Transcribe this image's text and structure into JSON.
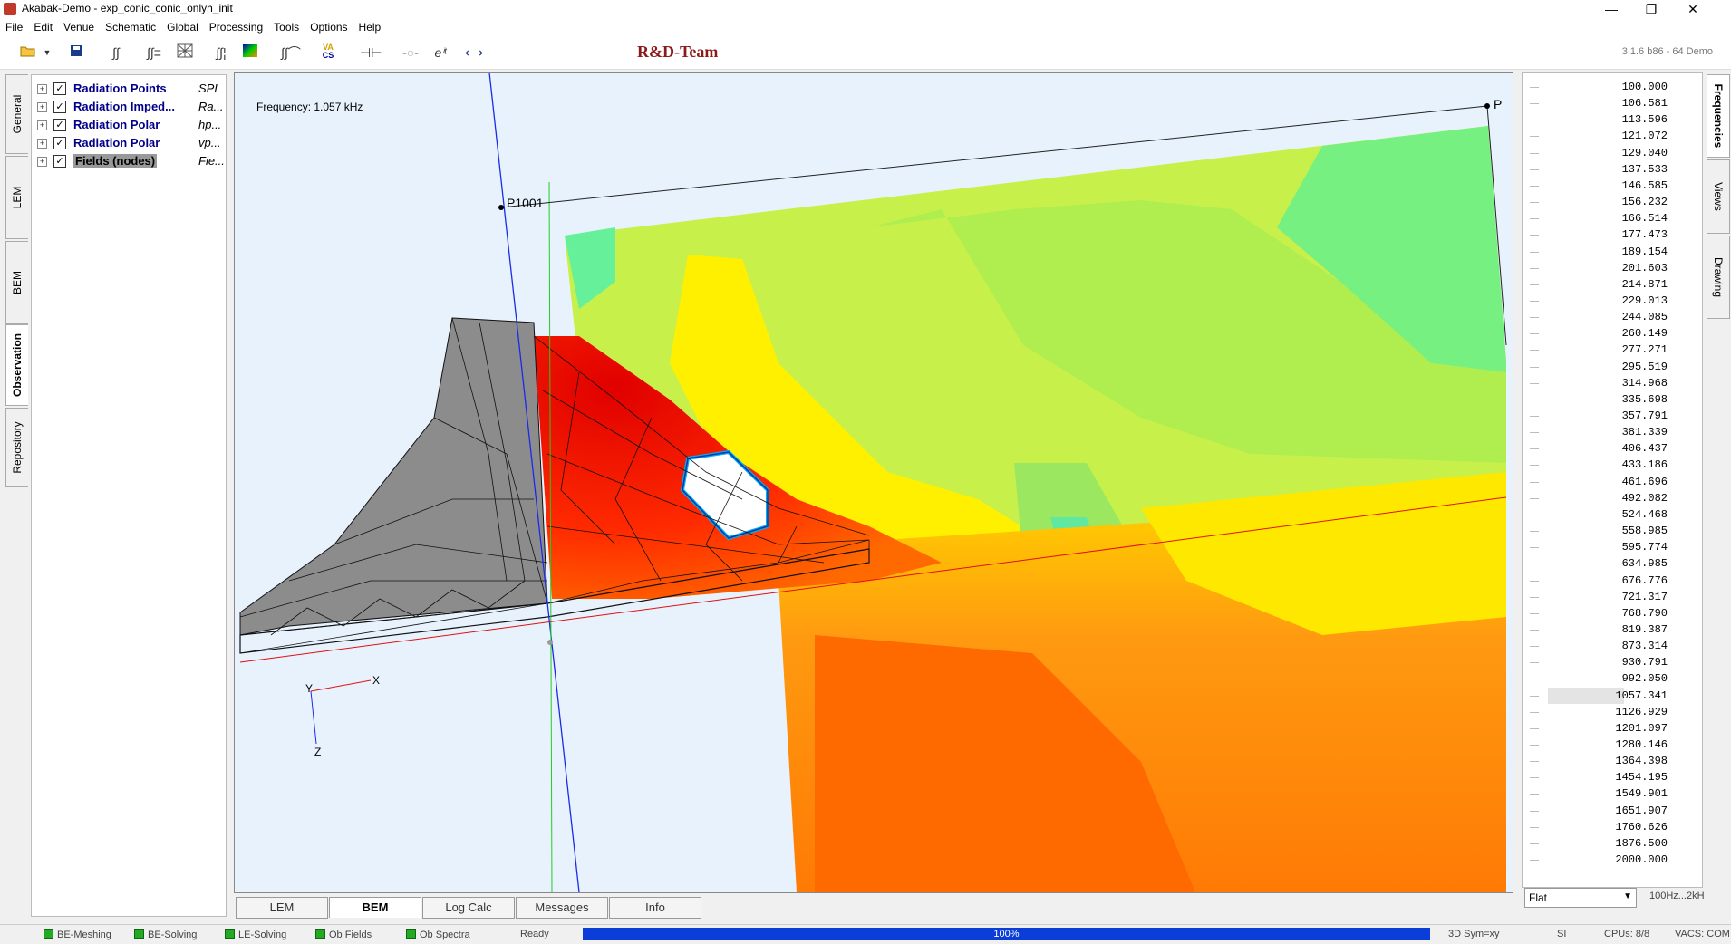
{
  "window": {
    "title": "Akabak-Demo - exp_conic_conic_onlyh_init",
    "minimize": "—",
    "restore": "❐",
    "close": "✕"
  },
  "menu": [
    "File",
    "Edit",
    "Venue",
    "Schematic",
    "Global",
    "Processing",
    "Tools",
    "Options",
    "Help"
  ],
  "toolbar": {
    "icons": [
      "open-folder-icon",
      "dropdown-arrow-icon",
      "save-icon",
      "integral-icon",
      "double-integral-icon",
      "mesh-icon",
      "integral-bars-icon",
      "color-map-icon",
      "integral-curve-icon",
      "vacs-icon",
      "component-icon",
      "filter-icon",
      "exp-icon",
      "arrow-icon"
    ],
    "vacs_label_top": "VA",
    "vacs_label_bottom": "CS",
    "exp_label": "eⁱᵗ",
    "team": "R&D-Team",
    "version": "3.1.6 b86 - 64 Demo"
  },
  "left_tabs": [
    "General",
    "LEM",
    "BEM",
    "Observation",
    "Repository"
  ],
  "active_left_tab": "Observation",
  "tree": [
    {
      "label": "Radiation Points",
      "value": "SPL",
      "checked": true
    },
    {
      "label": "Radiation Imped...",
      "value": "Ra...",
      "checked": true
    },
    {
      "label": "Radiation Polar",
      "value": "hp...",
      "checked": true
    },
    {
      "label": "Radiation Polar",
      "value": "vp...",
      "checked": true
    },
    {
      "label": "Fields (nodes)",
      "value": "Fie...",
      "checked": true,
      "selected": true
    }
  ],
  "viewport": {
    "frequency": "Frequency: 1.057 kHz",
    "point_p": "P",
    "point_p1001": "P1001",
    "axis_x": "X",
    "axis_y": "Y",
    "axis_z": "Z"
  },
  "bottom_tabs": [
    "LEM",
    "BEM",
    "Log Calc",
    "Messages",
    "Info"
  ],
  "active_bottom_tab": "BEM",
  "frequencies": [
    "100.000",
    "106.581",
    "113.596",
    "121.072",
    "129.040",
    "137.533",
    "146.585",
    "156.232",
    "166.514",
    "177.473",
    "189.154",
    "201.603",
    "214.871",
    "229.013",
    "244.085",
    "260.149",
    "277.271",
    "295.519",
    "314.968",
    "335.698",
    "357.791",
    "381.339",
    "406.437",
    "433.186",
    "461.696",
    "492.082",
    "524.468",
    "558.985",
    "595.774",
    "634.985",
    "676.776",
    "721.317",
    "768.790",
    "819.387",
    "873.314",
    "930.791",
    "992.050",
    "1057.341",
    "1126.929",
    "1201.097",
    "1280.146",
    "1364.398",
    "1454.195",
    "1549.901",
    "1651.907",
    "1760.626",
    "1876.500",
    "2000.000"
  ],
  "selected_frequency": "1057.341",
  "right_tabs": [
    "Frequencies",
    "Views",
    "Drawing"
  ],
  "active_right_tab": "Frequencies",
  "filter": {
    "value": "Flat",
    "range": "100Hz...2kH"
  },
  "status": {
    "items": [
      "BE-Meshing",
      "BE-Solving",
      "LE-Solving",
      "Ob Fields",
      "Ob Spectra"
    ],
    "ready": "Ready",
    "progress": "100%",
    "sym": "3D Sym=xy",
    "units": "SI",
    "cpus": "CPUs: 8/8",
    "vacs": "VACS: COM"
  }
}
